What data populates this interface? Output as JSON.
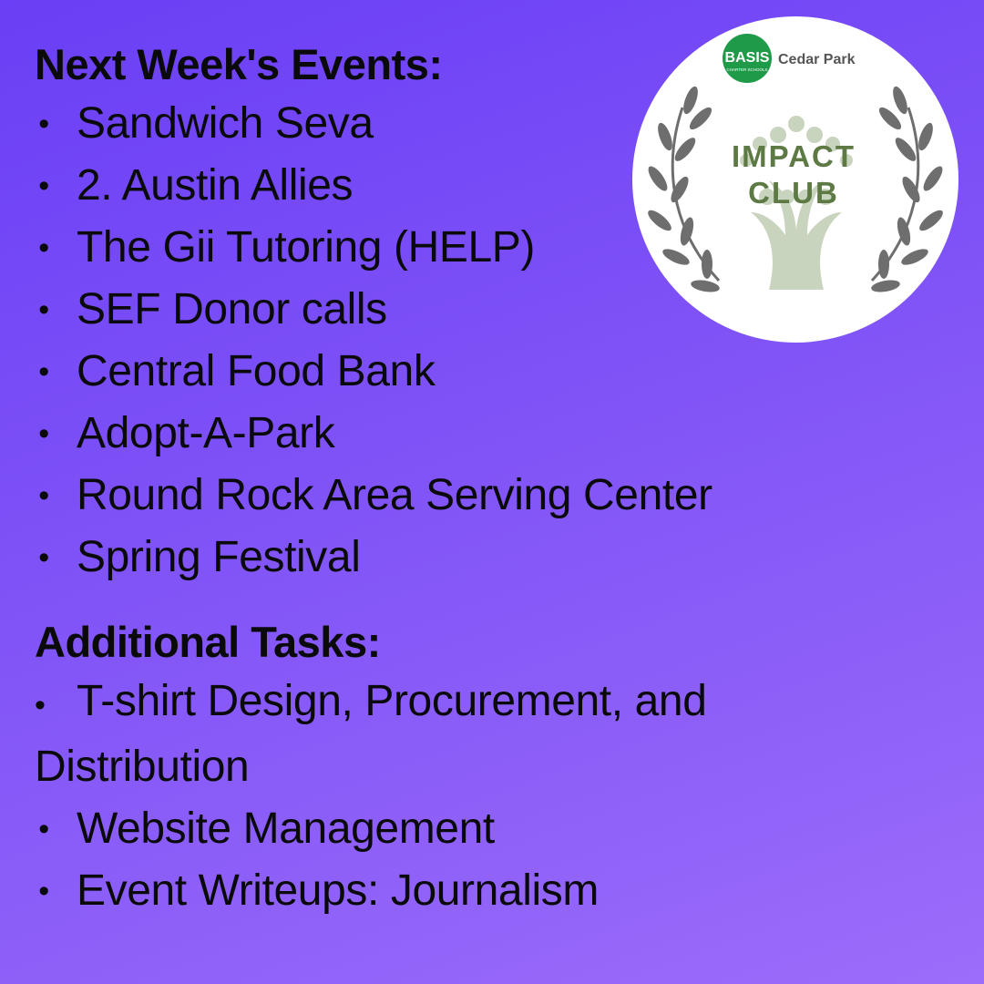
{
  "events": {
    "heading": "Next Week's Events:",
    "items": [
      "Sandwich Seva",
      "2. Austin Allies",
      "The Gii Tutoring (HELP)",
      "SEF Donor calls",
      "Central Food Bank",
      "Adopt-A-Park",
      "Round Rock Area Serving Center",
      "Spring Festival"
    ]
  },
  "tasks": {
    "heading": "Additional Tasks:",
    "items": [
      "T-shirt Design, Procurement, and Distribution",
      "Website Management",
      "Event Writeups: Journalism"
    ]
  },
  "bullet": "•",
  "logo": {
    "school": "BASIS",
    "school_sub": "CHARTER SCHOOLS",
    "campus": "Cedar Park",
    "club_line1": "IMPACT",
    "club_line2": "CLUB",
    "colors": {
      "green": "#1e9a48",
      "olive": "#5d7a44",
      "leaf": "#6e6e6e",
      "tree": "#c9d4bf"
    }
  }
}
